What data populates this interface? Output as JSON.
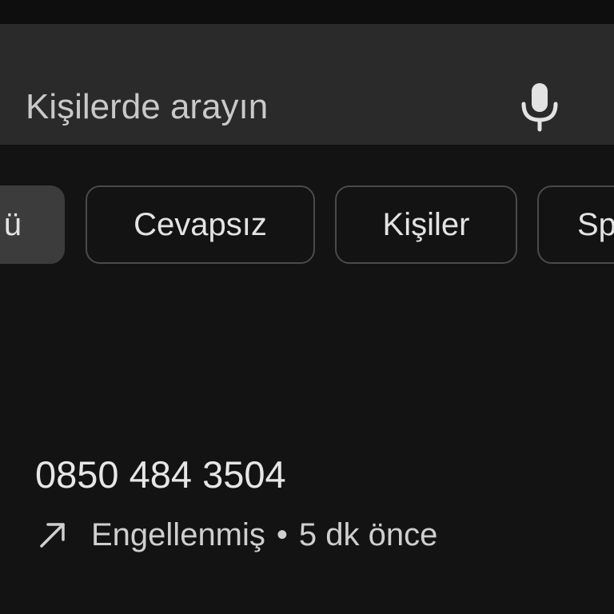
{
  "search": {
    "placeholder": "Kişilerde arayın",
    "mic_icon": "microphone-icon"
  },
  "filters": {
    "items": [
      {
        "label": "ü",
        "selected": true
      },
      {
        "label": "Cevapsız",
        "selected": false
      },
      {
        "label": "Kişiler",
        "selected": false
      },
      {
        "label": "Sp",
        "selected": false
      }
    ]
  },
  "call_log": {
    "entries": [
      {
        "number": "0850 484 3504",
        "direction_icon": "outgoing-call-arrow-icon",
        "status": "Engellenmiş",
        "separator": "•",
        "time": "5 dk önce"
      }
    ]
  },
  "colors": {
    "background": "#131313",
    "search_bar": "#2a2a2a",
    "chip_selected": "#3c3c3c",
    "chip_border": "#4a4a4a",
    "text": "#e3e3e3"
  }
}
